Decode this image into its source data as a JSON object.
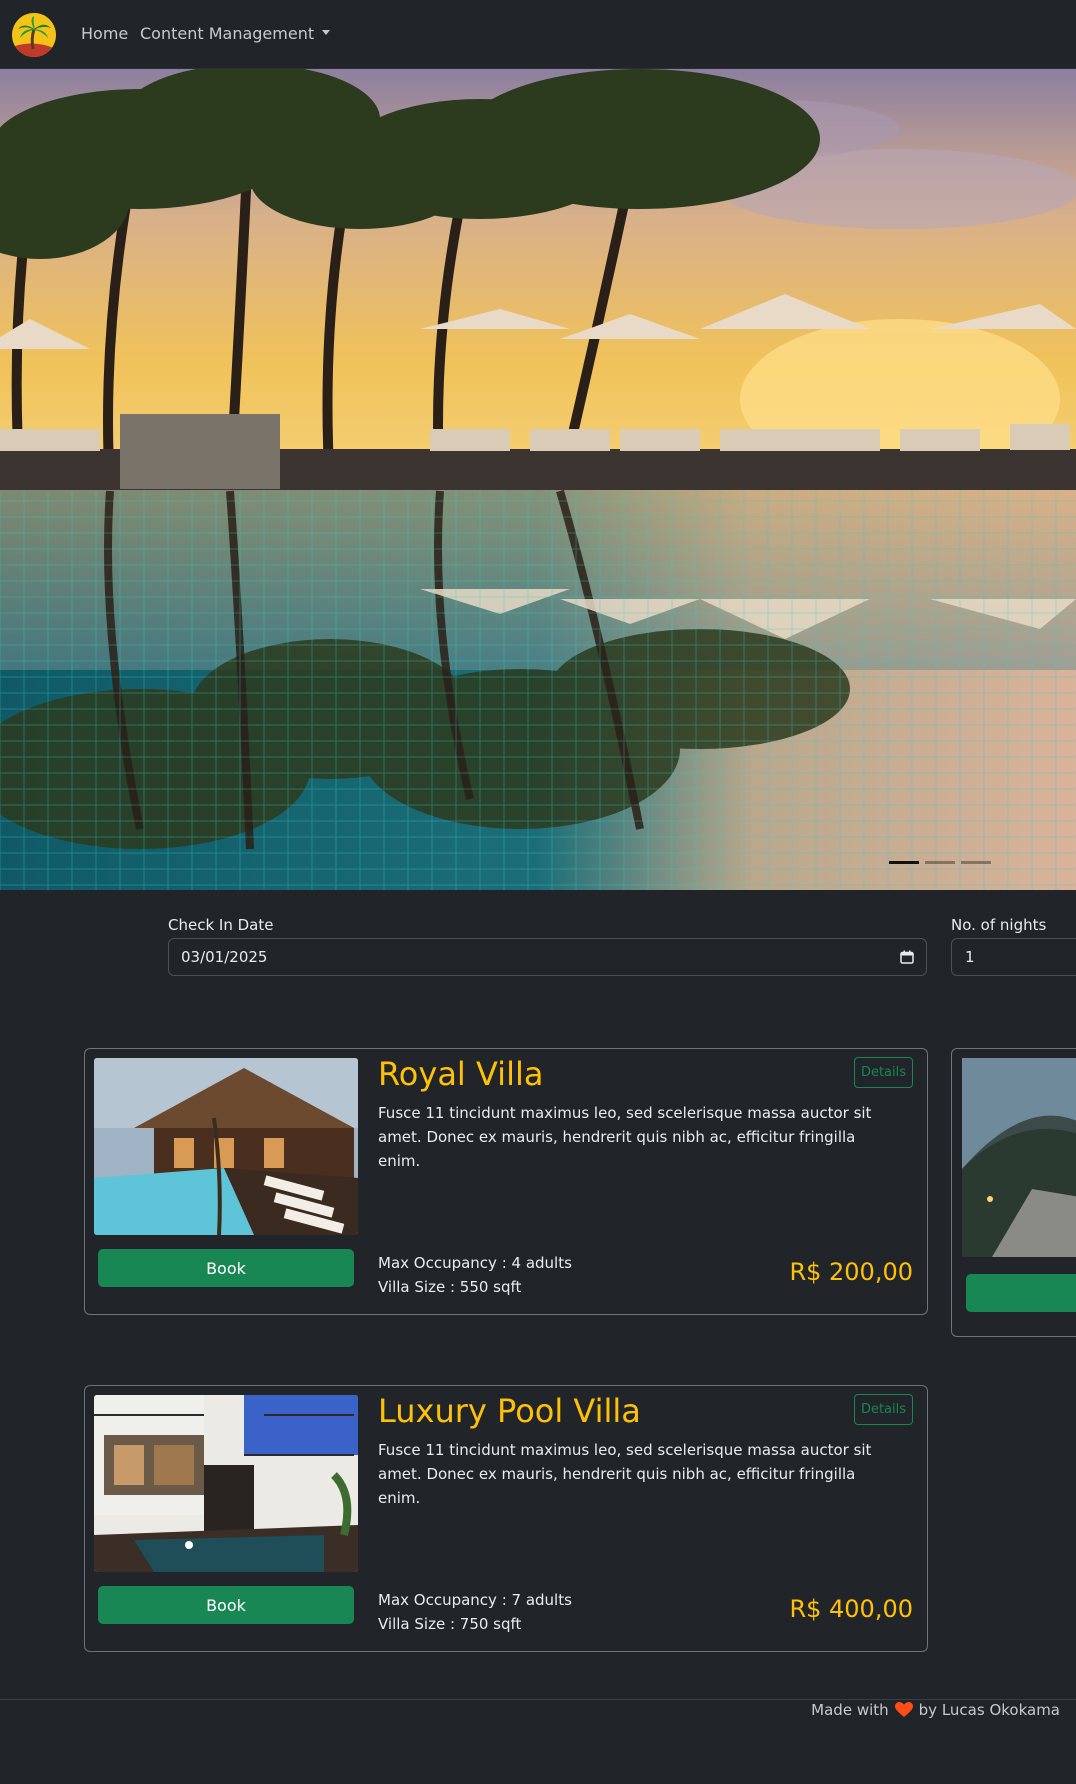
{
  "navbar": {
    "logo": "palm-tree-logo",
    "home_label": "Home",
    "content_label": "Content Management"
  },
  "hero": {
    "indicators": 3,
    "active_index": 0
  },
  "search": {
    "checkin_label": "Check In Date",
    "checkin_value": "03/01/2025",
    "nights_label": "No. of nights",
    "nights_value": "1"
  },
  "villas": [
    {
      "title": "Royal Villa",
      "description": "Fusce 11 tincidunt maximus leo, sed scelerisque massa auctor sit amet. Donec ex mauris, hendrerit quis nibh ac, efficitur fringilla enim.",
      "details_label": "Details",
      "book_label": "Book",
      "occupancy": "Max Occupancy : 4 adults",
      "size": "Villa Size : 550 sqft",
      "price": "R$ 200,00"
    },
    {
      "title": "Luxury Pool Villa",
      "description": "Fusce 11 tincidunt maximus leo, sed scelerisque massa auctor sit amet. Donec ex mauris, hendrerit quis nibh ac, efficitur fringilla enim.",
      "details_label": "Details",
      "book_label": "Book",
      "occupancy": "Max Occupancy : 7 adults",
      "size": "Villa Size : 750 sqft",
      "price": "R$ 400,00"
    }
  ],
  "footer": {
    "made_with": "Made with",
    "by": "by Lucas Okokama"
  },
  "colors": {
    "accent": "#ffc107",
    "success": "#198754",
    "background": "#212529",
    "heart": "#ff4d1a"
  }
}
